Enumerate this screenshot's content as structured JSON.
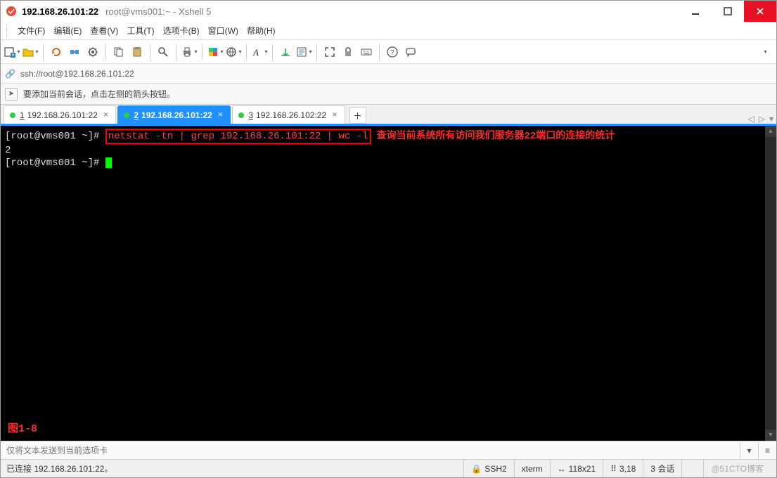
{
  "title": {
    "main": "192.168.26.101:22",
    "sub": "root@vms001:~ - Xshell 5"
  },
  "menu": {
    "file": "文件(F)",
    "edit": "编辑(E)",
    "view": "查看(V)",
    "tools": "工具(T)",
    "tabs": "选项卡(B)",
    "window": "窗口(W)",
    "help": "帮助(H)"
  },
  "addressbar": {
    "url": "ssh://root@192.168.26.101:22"
  },
  "tipbar": {
    "text": "要添加当前会话，点击左侧的箭头按钮。"
  },
  "tabs": {
    "items": [
      {
        "num": "1",
        "label": "192.168.26.101:22"
      },
      {
        "num": "2",
        "label": "192.168.26.101:22"
      },
      {
        "num": "3",
        "label": "192.168.26.102:22"
      }
    ]
  },
  "terminal": {
    "prompt1": "[root@vms001 ~]# ",
    "command": "netstat -tn | grep 192.168.26.101:22 | wc -l",
    "annotation": "查询当前系统所有访问我们服务器22端口的连接的统计",
    "output": "2",
    "prompt2": "[root@vms001 ~]# ",
    "figure": "图1-8"
  },
  "sendbar": {
    "placeholder": "仅将文本发送到当前选项卡"
  },
  "status": {
    "conn": "已连接 192.168.26.101:22。",
    "ssh": "SSH2",
    "term": "xterm",
    "size": "118x21",
    "pos": "3,18",
    "sessions": "3 会话",
    "watermark": "@51CTO博客"
  }
}
